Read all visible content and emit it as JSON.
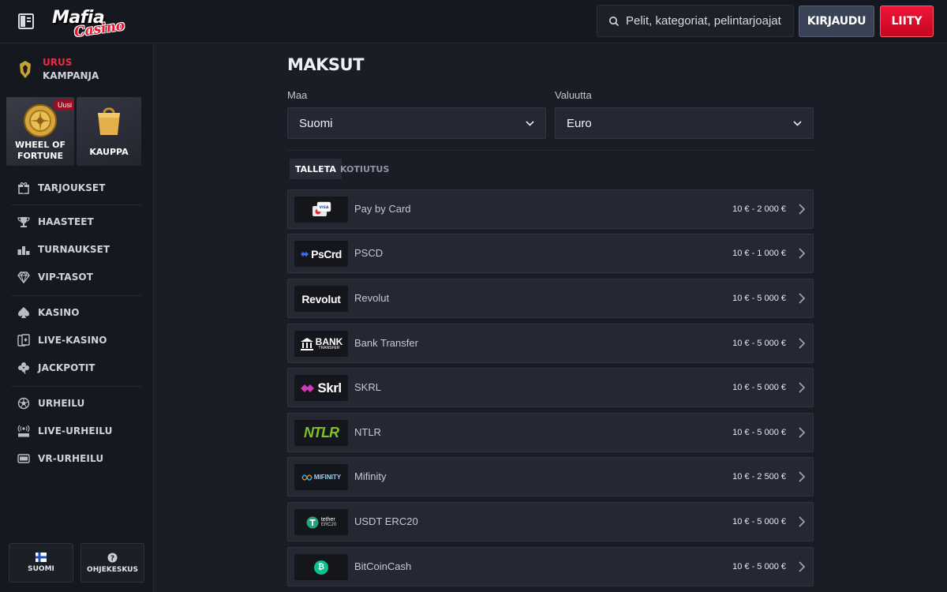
{
  "header": {
    "logo_main": "Mafia",
    "logo_sub": "Casino",
    "search_placeholder": "Pelit, kategoriat, pelintarjoajat",
    "login_label": "KIRJAUDU",
    "join_label": "LIITY"
  },
  "sidebar": {
    "campaign": {
      "line1": "URUS",
      "line2": "KAMPANJA"
    },
    "promos": [
      {
        "label_line1": "WHEEL OF",
        "label_line2": "FORTUNE",
        "badge": "Uusi"
      },
      {
        "label_line1": "KAUPPA",
        "label_line2": ""
      }
    ],
    "items": [
      {
        "label": "TARJOUKSET",
        "icon": "gift-icon"
      },
      {
        "label": "HAASTEET",
        "icon": "trophy-icon"
      },
      {
        "label": "TURNAUKSET",
        "icon": "podium-icon"
      },
      {
        "label": "VIP-TASOT",
        "icon": "diamond-icon"
      },
      {
        "label": "KASINO",
        "icon": "spade-icon"
      },
      {
        "label": "LIVE-KASINO",
        "icon": "cards-icon"
      },
      {
        "label": "JACKPOTIT",
        "icon": "clover-icon"
      },
      {
        "label": "URHEILU",
        "icon": "ball-icon"
      },
      {
        "label": "LIVE-URHEILU",
        "icon": "live-icon"
      },
      {
        "label": "VR-URHEILU",
        "icon": "vr-icon"
      }
    ],
    "footer": {
      "language_label": "SUOMI",
      "help_label": "OHJEKESKUS"
    }
  },
  "main": {
    "title": "MAKSUT",
    "country": {
      "label": "Maa",
      "value": "Suomi"
    },
    "currency": {
      "label": "Valuutta",
      "value": "Euro"
    },
    "tabs": [
      {
        "label": "TALLETA",
        "active": true
      },
      {
        "label": "KOTIUTUS",
        "active": false
      }
    ],
    "methods": [
      {
        "name": "Pay by Card",
        "range": "10 € - 2 000 €",
        "logo_text": "VISA"
      },
      {
        "name": "PSCD",
        "range": "10 € - 1 000 €",
        "logo_text": "PsCrd"
      },
      {
        "name": "Revolut",
        "range": "10 € - 5 000 €",
        "logo_text": "Revolut"
      },
      {
        "name": "Bank Transfer",
        "range": "10 € - 5 000 €",
        "logo_text": "BANK",
        "logo_sub": "TRANSFER"
      },
      {
        "name": "SKRL",
        "range": "10 € - 5 000 €",
        "logo_text": "Skrl"
      },
      {
        "name": "NTLR",
        "range": "10 € - 5 000 €",
        "logo_text": "NTLR"
      },
      {
        "name": "Mifinity",
        "range": "10 € - 2 500 €",
        "logo_text": "MIFINITY"
      },
      {
        "name": "USDT ERC20",
        "range": "10 € - 5 000 €",
        "logo_text": "tether",
        "logo_sub": "ERC20"
      },
      {
        "name": "BitCoinCash",
        "range": "10 € - 5 000 €",
        "logo_text": "₿"
      }
    ]
  },
  "colors": {
    "background": "#1b1d26",
    "panel": "#16181f",
    "row": "#252833",
    "accent_red": "#e0162f",
    "login_button": "#3a4256"
  }
}
